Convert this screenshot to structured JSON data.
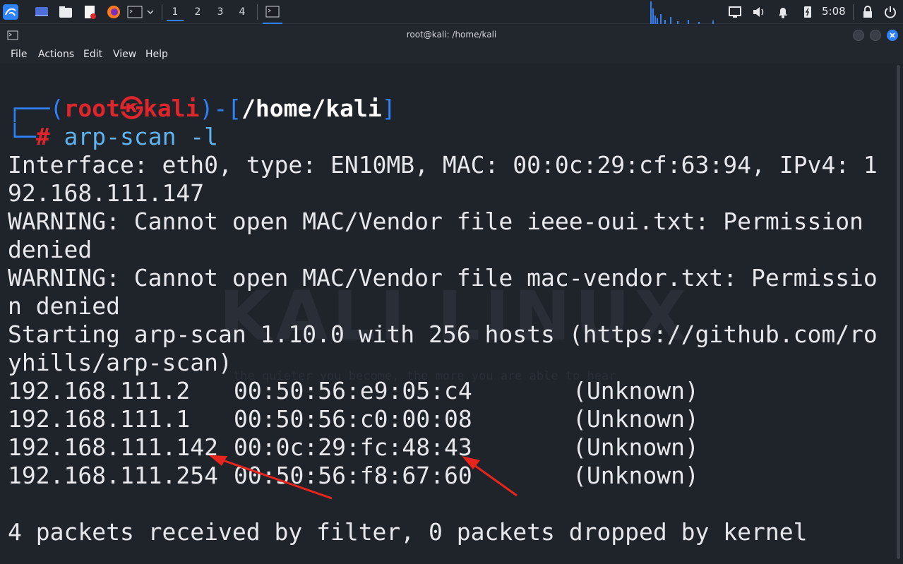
{
  "panel": {
    "workspaces": [
      "1",
      "2",
      "3",
      "4"
    ],
    "clock": "5:08"
  },
  "window": {
    "title": "root@kali: /home/kali"
  },
  "menu": [
    "File",
    "Actions",
    "Edit",
    "View",
    "Help"
  ],
  "desktop_watermark": {
    "brand": "KALI LINUX",
    "tagline": "the quieter you become, the more you are able to hear"
  },
  "prompt": {
    "open": "┌──(",
    "user": "root",
    "host": "kali",
    "mid": ")-[",
    "path": "/home/kali",
    "close": "]",
    "corner": "└─",
    "symbol": "#",
    "command": "arp-scan -l"
  },
  "output_lines": [
    "Interface: eth0, type: EN10MB, MAC: 00:0c:29:cf:63:94, IPv4: 1",
    "92.168.111.147",
    "WARNING: Cannot open MAC/Vendor file ieee-oui.txt: Permission",
    "denied",
    "WARNING: Cannot open MAC/Vendor file mac-vendor.txt: Permissio",
    "n denied",
    "Starting arp-scan 1.10.0 with 256 hosts (https://github.com/ro",
    "yhills/arp-scan)"
  ],
  "hosts": [
    {
      "ip": "192.168.111.2",
      "mac": "00:50:56:e9:05:c4",
      "vendor": "(Unknown)"
    },
    {
      "ip": "192.168.111.1",
      "mac": "00:50:56:c0:00:08",
      "vendor": "(Unknown)"
    },
    {
      "ip": "192.168.111.142",
      "mac": "00:0c:29:fc:48:43",
      "vendor": "(Unknown)"
    },
    {
      "ip": "192.168.111.254",
      "mac": "00:50:56:f8:67:60",
      "vendor": "(Unknown)"
    }
  ],
  "summary": "4 packets received by filter, 0 packets dropped by kernel",
  "colors": {
    "accent": "#2f81f7",
    "prompt_user": "#e0262c",
    "annotation_arrow": "#e8251d"
  }
}
